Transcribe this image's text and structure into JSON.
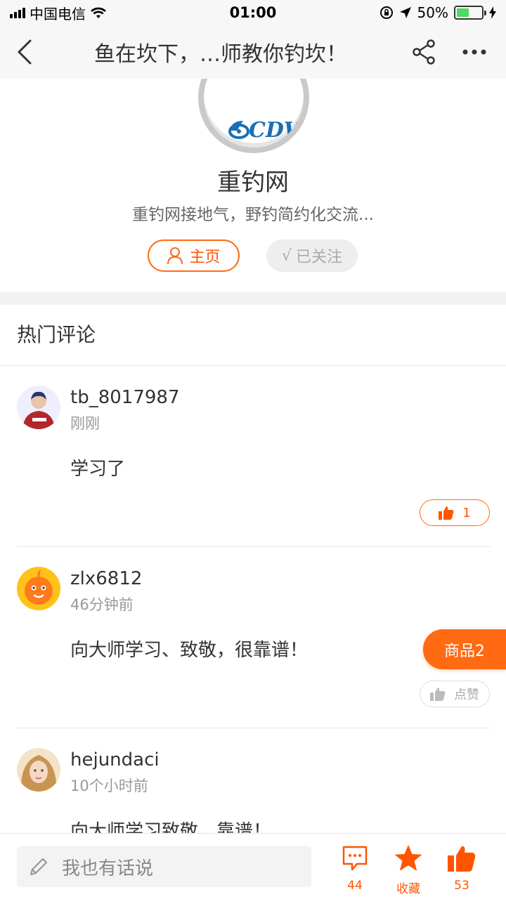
{
  "status_bar": {
    "carrier": "中国电信",
    "time": "01:00",
    "battery": "50%"
  },
  "nav": {
    "title": "鱼在坎下，…师教你钓坎！"
  },
  "profile": {
    "logo_text": "CDW",
    "logo_sub": "重钓网",
    "name": "重钓网",
    "description": "重钓网接地气，野钓简约化交流...",
    "home_button": "主页",
    "follow_button": "已关注"
  },
  "section_title": "热门评论",
  "comments": [
    {
      "user": "tb_8017987",
      "time": "刚刚",
      "text": "学习了",
      "like_label": "1",
      "liked": true
    },
    {
      "user": "zlx6812",
      "time": "46分钟前",
      "text": "向大师学习、致敬，很靠谱！",
      "like_label": "点赞",
      "liked": false
    },
    {
      "user": "hejundaci",
      "time": "10个小时前",
      "text": "向大师学习致敬，靠谱！"
    }
  ],
  "goods_badge": "商品2",
  "bottom_bar": {
    "input_placeholder": "我也有话说",
    "comment_count": "44",
    "favorite_label": "收藏",
    "like_count": "53"
  },
  "colors": {
    "accent": "#ff6a13",
    "text": "#333333",
    "muted": "#999999"
  }
}
